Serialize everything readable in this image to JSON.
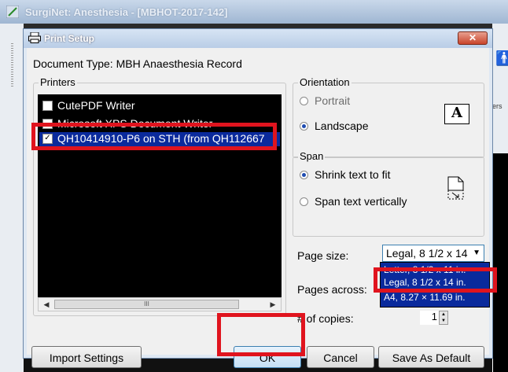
{
  "app": {
    "title": "SurgiNet: Anesthesia - [MBHOT-2017-142]"
  },
  "side": {
    "ers_text": "ers"
  },
  "dialog": {
    "title": "Print Setup",
    "close_label": "✕",
    "document_type": "Document Type: MBH Anaesthesia Record"
  },
  "printers": {
    "label": "Printers",
    "items": [
      {
        "name": "CutePDF Writer",
        "checked": false
      },
      {
        "name": "Microsoft XPS Document Writer",
        "checked": false
      },
      {
        "name": "QH10414910-P6 on STH (from QH112667",
        "checked": true
      }
    ],
    "scroll_thumb_glyph": "III"
  },
  "orientation": {
    "label": "Orientation",
    "portrait": "Portrait",
    "landscape": "Landscape",
    "selected": "landscape",
    "icon_letter": "A"
  },
  "span": {
    "label": "Span",
    "shrink": "Shrink text to fit",
    "vertical": "Span text vertically",
    "selected": "shrink"
  },
  "page_size": {
    "label": "Page size:",
    "selected": "Legal, 8 1/2 x 14",
    "options": [
      "Letter, 8 1/2 x 11 in.",
      "Legal, 8 1/2 x 14 in.",
      "A4, 8.27 × 11.69 in."
    ],
    "highlighted_option": "A4, 8.27 × 11.69 in."
  },
  "pages_across": {
    "label": "Pages across:"
  },
  "copies": {
    "label": "# of copies:",
    "value": "1"
  },
  "buttons": {
    "import": "Import Settings",
    "ok": "OK",
    "cancel": "Cancel",
    "save_default": "Save As Default"
  },
  "colors": {
    "highlight": "#e0141e",
    "selection": "#0a2a9c",
    "list_background": "#000000"
  }
}
